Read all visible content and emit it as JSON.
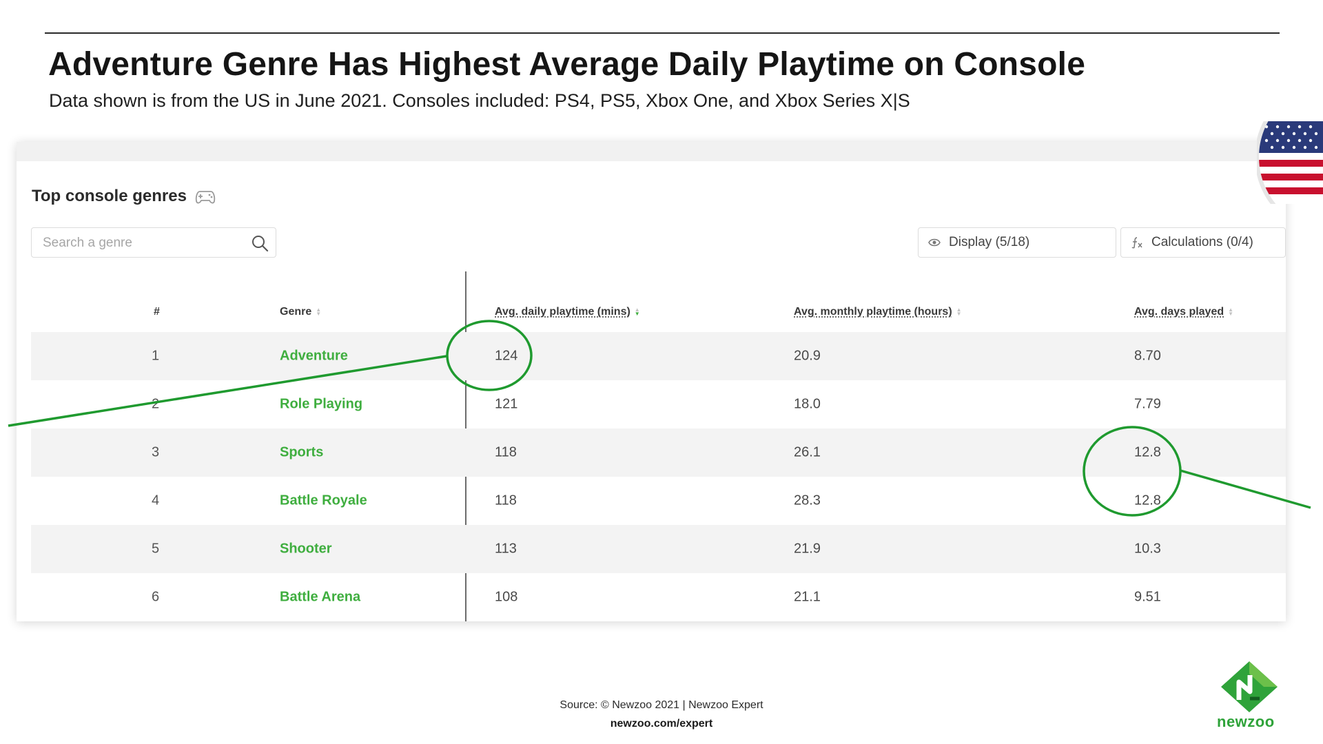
{
  "header": {
    "title": "Adventure Genre Has Highest Average Daily Playtime on Console",
    "subtitle": "Data shown is from the US in June 2021. Consoles included: PS4, PS5, Xbox One, and Xbox Series X|S"
  },
  "widget": {
    "title": "Top console genres",
    "search_placeholder": "Search a genre",
    "display_label": "Display (5/18)",
    "calculations_label": "Calculations (0/4)"
  },
  "table": {
    "columns": [
      "#",
      "Genre",
      "Avg. daily playtime (mins)",
      "Avg. monthly playtime (hours)",
      "Avg. days played"
    ],
    "rows": [
      {
        "rank": "1",
        "genre": "Adventure",
        "daily": "124",
        "monthly": "20.9",
        "days": "8.70"
      },
      {
        "rank": "2",
        "genre": "Role Playing",
        "daily": "121",
        "monthly": "18.0",
        "days": "7.79"
      },
      {
        "rank": "3",
        "genre": "Sports",
        "daily": "118",
        "monthly": "26.1",
        "days": "12.8"
      },
      {
        "rank": "4",
        "genre": "Battle Royale",
        "daily": "118",
        "monthly": "28.3",
        "days": "12.8"
      },
      {
        "rank": "5",
        "genre": "Shooter",
        "daily": "113",
        "monthly": "21.9",
        "days": "10.3"
      },
      {
        "rank": "6",
        "genre": "Battle Arena",
        "daily": "108",
        "monthly": "21.1",
        "days": "9.51"
      }
    ]
  },
  "footer": {
    "source": "Source: © Newzoo 2021 | Newzoo Expert",
    "url": "newzoo.com/expert",
    "brand": "newzoo"
  },
  "colors": {
    "accent_green": "#3fae3f",
    "annotation_green": "#1f9a2f",
    "row_shade": "#f3f3f3"
  },
  "icons": [
    "gamepad-icon",
    "search-icon",
    "eye-icon",
    "fx-icon",
    "sort-icon",
    "us-flag",
    "newzoo-logo"
  ]
}
